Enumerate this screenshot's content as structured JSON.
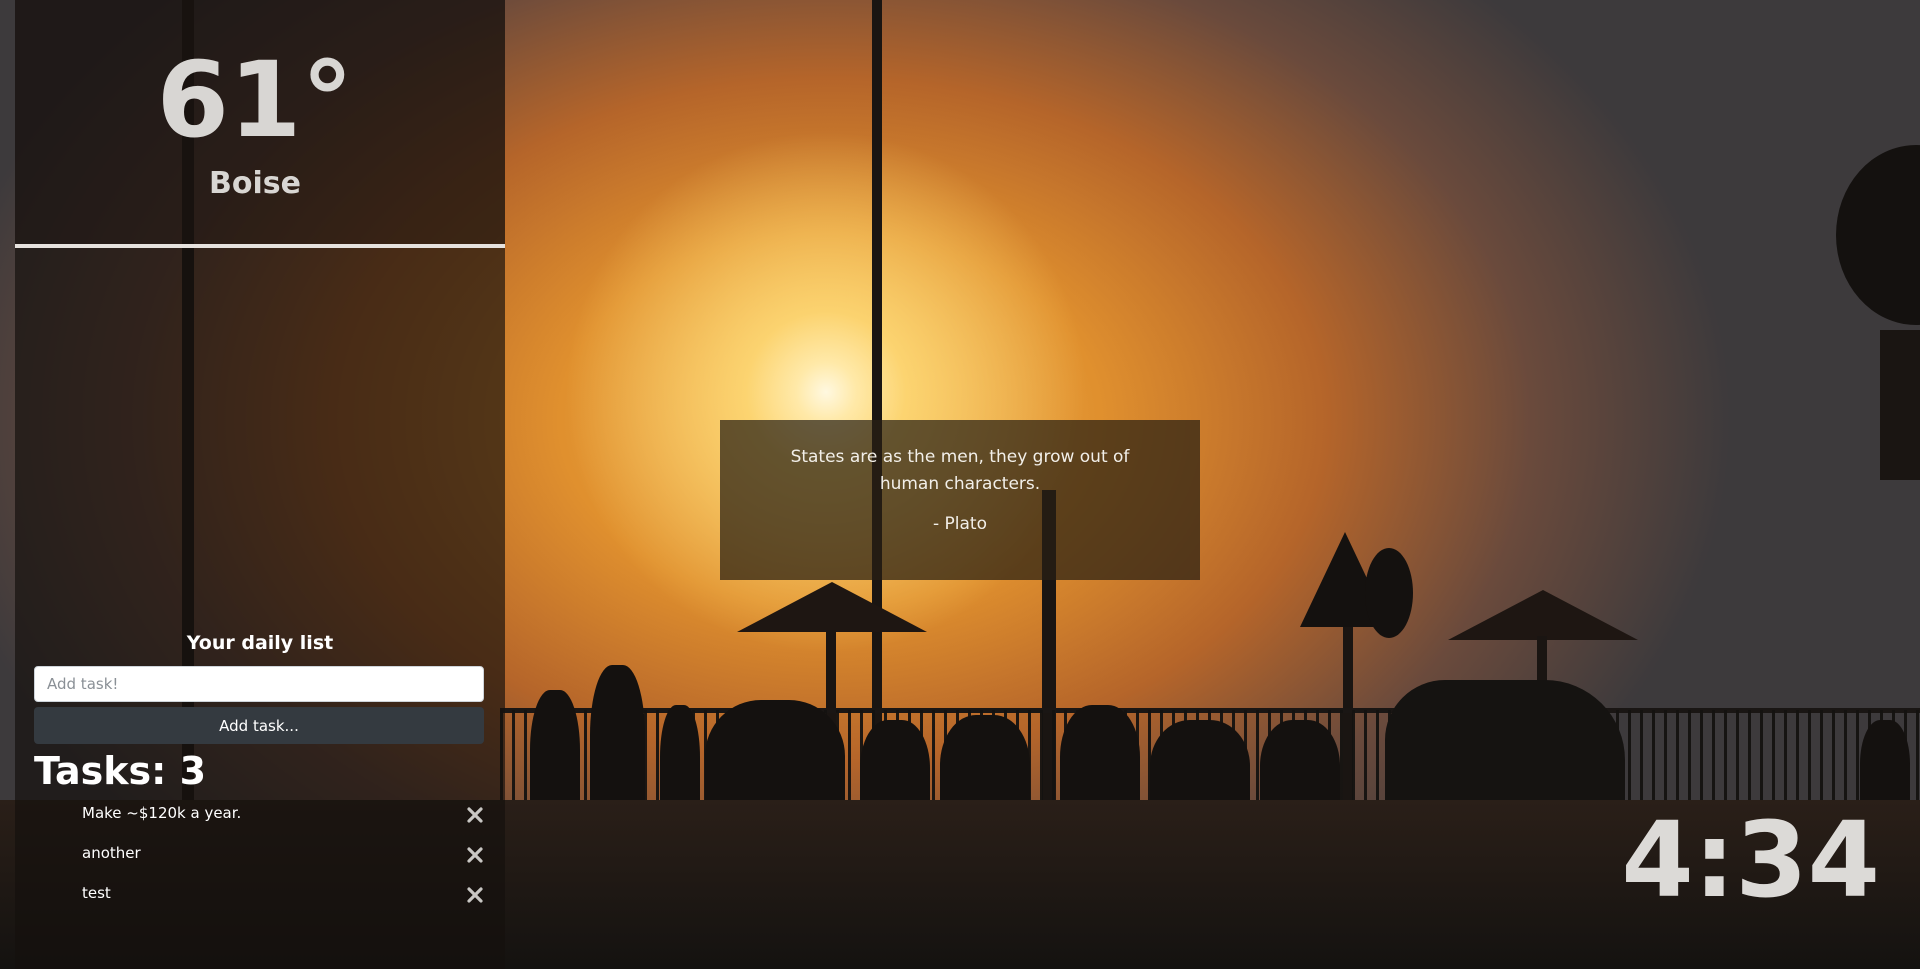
{
  "weather": {
    "temperature": "61°",
    "city": "Boise"
  },
  "quote": {
    "text": "States are as the men, they grow out of human characters.",
    "author": "- Plato"
  },
  "todo": {
    "title": "Your daily list",
    "input_placeholder": "Add task!",
    "add_button_label": "Add task...",
    "task_count_label": "Tasks: 3",
    "tasks": [
      {
        "text": "Make ~$120k a year."
      },
      {
        "text": "another"
      },
      {
        "text": "test"
      }
    ],
    "delete_icon": "close-icon"
  },
  "clock": {
    "time": "4:34"
  }
}
